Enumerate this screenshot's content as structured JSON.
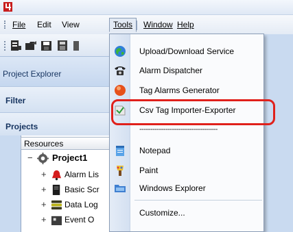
{
  "menubar": {
    "file": "File",
    "edit": "Edit",
    "view": "View",
    "tools": "Tools",
    "window": "Window",
    "help": "Help"
  },
  "explorer": {
    "title": "Project Explorer",
    "filter_label": "Filter",
    "projects_label": "Projects",
    "resources_header": "Resources",
    "tree": [
      {
        "label": "Project1",
        "expander": "−",
        "icon": "gear-icon"
      },
      {
        "label": "Alarm Lis",
        "expander": "+",
        "icon": "alarm-bell-icon"
      },
      {
        "label": "Basic Scr",
        "expander": "+",
        "icon": "script-icon"
      },
      {
        "label": "Data Log",
        "expander": "+",
        "icon": "database-icon"
      },
      {
        "label": "Event O",
        "expander": "+",
        "icon": "event-icon"
      }
    ]
  },
  "tools_menu": {
    "items": [
      {
        "label": "Upload/Download Service",
        "icon": "globe-icon"
      },
      {
        "label": "Alarm Dispatcher",
        "icon": "telephone-icon"
      },
      {
        "label": "Tag Alarms Generator",
        "icon": "red-orb-icon"
      },
      {
        "label": "Csv Tag Importer-Exporter",
        "icon": "csv-import-icon",
        "highlighted": true
      },
      {
        "label": "Notepad",
        "icon": "notepad-icon"
      },
      {
        "label": "Paint",
        "icon": "paint-icon"
      },
      {
        "label": "Windows Explorer",
        "icon": "explorer-icon"
      },
      {
        "label": "Customize...",
        "icon": ""
      }
    ],
    "separator_text": "------------------------------------"
  },
  "colors": {
    "highlight_ring": "#e0201b",
    "menu_gutter": "#d4e0f1"
  }
}
